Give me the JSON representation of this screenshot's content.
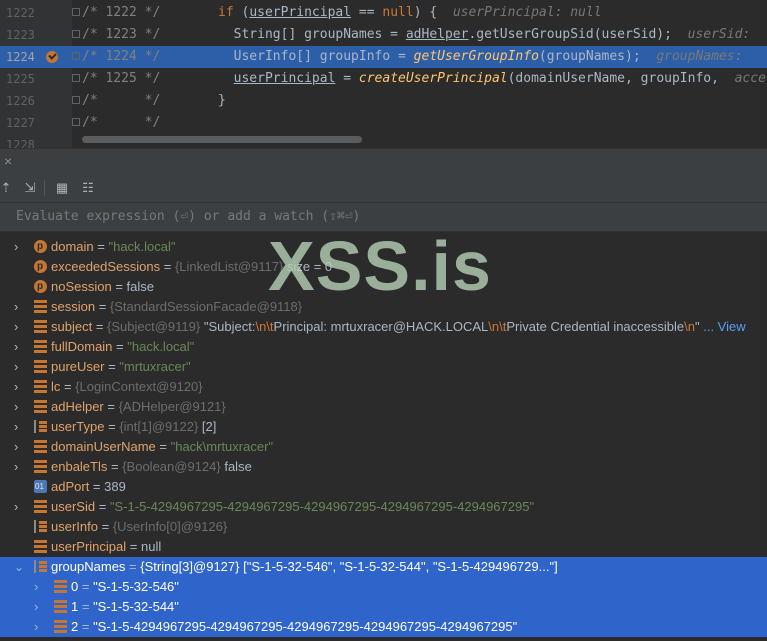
{
  "editor": {
    "lines": [
      {
        "num": "1222",
        "comment": "/* 1222 */",
        "code_html": "<span class='kw'>if</span> (<span class='ul'>userPrincipal</span> == <span class='kw'>null</span>) {  <span class='hint'>userPrincipal: null</span>",
        "current": false
      },
      {
        "num": "1223",
        "comment": "/* 1223 */",
        "code_html": "  String[] groupNames = <span class='ul'>adHelper</span>.getUserGroupSid(userSid);  <span class='hint'>userSid: </span>",
        "current": false
      },
      {
        "num": "1224",
        "comment": "/* 1224 */",
        "code_html": "  UserInfo[] groupInfo = <span class='fn'>getUserGroupInfo</span>(groupNames);  <span class='hint'>groupNames: </span>",
        "current": true
      },
      {
        "num": "1225",
        "comment": "/* 1225 */",
        "code_html": "  <span class='ul'>userPrincipal</span> = <span class='fn'>createUserPrincipal</span>(domainUserName, groupInfo,  <span class='hint'>acce</span>",
        "current": false
      },
      {
        "num": "1226",
        "comment": "/*      */",
        "code_html": "}",
        "current": false
      },
      {
        "num": "1227",
        "comment": "/*      */",
        "code_html": "",
        "current": false
      },
      {
        "num": "1228",
        "comment": "",
        "code_html": "",
        "current": false
      }
    ]
  },
  "debugger": {
    "close_icon": "×",
    "eval_placeholder": "Evaluate expression (⏎) or add a watch (⇧⌘⏎)"
  },
  "watermark": "XSS.is",
  "variables": [
    {
      "icon": "p",
      "arrow": "›",
      "name": "domain",
      "ref": "",
      "value": "\"hack.local\"",
      "vclass": "str"
    },
    {
      "icon": "p",
      "arrow": "",
      "name": "exceededSessions",
      "ref": "{LinkedList@9117}",
      "value": "size = 0",
      "vclass": "val"
    },
    {
      "icon": "p",
      "arrow": "",
      "name": "noSession",
      "ref": "",
      "value": "false",
      "vclass": "val"
    },
    {
      "icon": "f",
      "arrow": "›",
      "name": "session",
      "ref": "{StandardSessionFacade@9118}",
      "value": "",
      "vclass": "val"
    },
    {
      "icon": "f",
      "arrow": "›",
      "name": "subject",
      "ref": "{Subject@9119}",
      "value": "\"Subject:\\n\\tPrincipal: mrtuxracer@HACK.LOCAL\\n\\tPrivate Credential inaccessible\\n\"",
      "vclass": "val",
      "link": "... View"
    },
    {
      "icon": "f",
      "arrow": "›",
      "name": "fullDomain",
      "ref": "",
      "value": "\"hack.local\"",
      "vclass": "str"
    },
    {
      "icon": "f",
      "arrow": "›",
      "name": "pureUser",
      "ref": "",
      "value": "\"mrtuxracer\"",
      "vclass": "str"
    },
    {
      "icon": "f",
      "arrow": "›",
      "name": "lc",
      "ref": "{LoginContext@9120}",
      "value": "",
      "vclass": "val"
    },
    {
      "icon": "f",
      "arrow": "›",
      "name": "adHelper",
      "ref": "{ADHelper@9121}",
      "value": "",
      "vclass": "val"
    },
    {
      "icon": "arr",
      "arrow": "›",
      "name": "userType",
      "ref": "{int[1]@9122}",
      "value": "[2]",
      "vclass": "val"
    },
    {
      "icon": "f",
      "arrow": "›",
      "name": "domainUserName",
      "ref": "",
      "value": "\"hack\\mrtuxracer\"",
      "vclass": "str"
    },
    {
      "icon": "f",
      "arrow": "›",
      "name": "enbaleTls",
      "ref": "{Boolean@9124}",
      "value": "false",
      "vclass": "val"
    },
    {
      "icon": "num",
      "arrow": "",
      "name": "adPort",
      "ref": "",
      "value": "389",
      "vclass": "val"
    },
    {
      "icon": "f",
      "arrow": "›",
      "name": "userSid",
      "ref": "",
      "value": "\"S-1-5-4294967295-4294967295-4294967295-4294967295-4294967295\"",
      "vclass": "str"
    },
    {
      "icon": "arr",
      "arrow": "",
      "name": "userInfo",
      "ref": "{UserInfo[0]@9126}",
      "value": "",
      "vclass": "val"
    },
    {
      "icon": "f",
      "arrow": "",
      "name": "userPrincipal",
      "ref": "",
      "value": "null",
      "vclass": "val"
    },
    {
      "icon": "arr",
      "arrow": "⌄",
      "name": "groupNames",
      "ref": "{String[3]@9127}",
      "value": "[\"S-1-5-32-546\", \"S-1-5-32-544\", \"S-1-5-429496729...\"]",
      "vclass": "val",
      "selected": true
    },
    {
      "icon": "f",
      "arrow": "›",
      "name": "0",
      "ref": "",
      "value": "\"S-1-5-32-546\"",
      "vclass": "str",
      "child": true,
      "selected": true
    },
    {
      "icon": "f",
      "arrow": "›",
      "name": "1",
      "ref": "",
      "value": "\"S-1-5-32-544\"",
      "vclass": "str",
      "child": true,
      "selected": true
    },
    {
      "icon": "f",
      "arrow": "›",
      "name": "2",
      "ref": "",
      "value": "\"S-1-5-4294967295-4294967295-4294967295-4294967295-4294967295\"",
      "vclass": "str",
      "child": true,
      "selected": true
    }
  ]
}
